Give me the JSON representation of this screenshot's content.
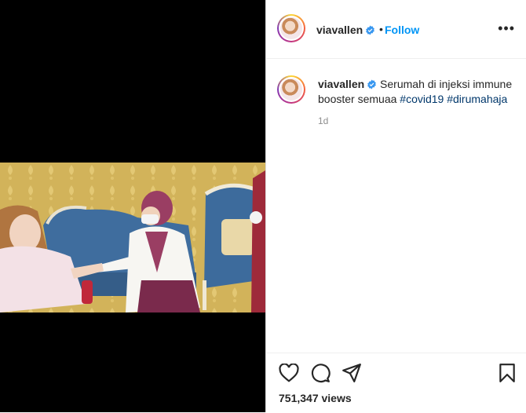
{
  "post": {
    "username": "viavallen",
    "follow_label": "Follow",
    "dot": "•",
    "more_label": "•••",
    "caption_text": "Serumah di injeksi immune booster semuaa",
    "hashtags": [
      "#covid19",
      "#dirumahaja"
    ],
    "time_ago": "1d",
    "views": "751,347 views"
  },
  "icons": {
    "verified": "verified-badge-icon",
    "like": "heart-icon",
    "comment": "comment-bubble-icon",
    "share": "paper-plane-icon",
    "save": "bookmark-icon"
  },
  "colors": {
    "accent": "#0095f6",
    "hashtag": "#00376b",
    "text": "#262626",
    "muted": "#8e8e8e"
  }
}
